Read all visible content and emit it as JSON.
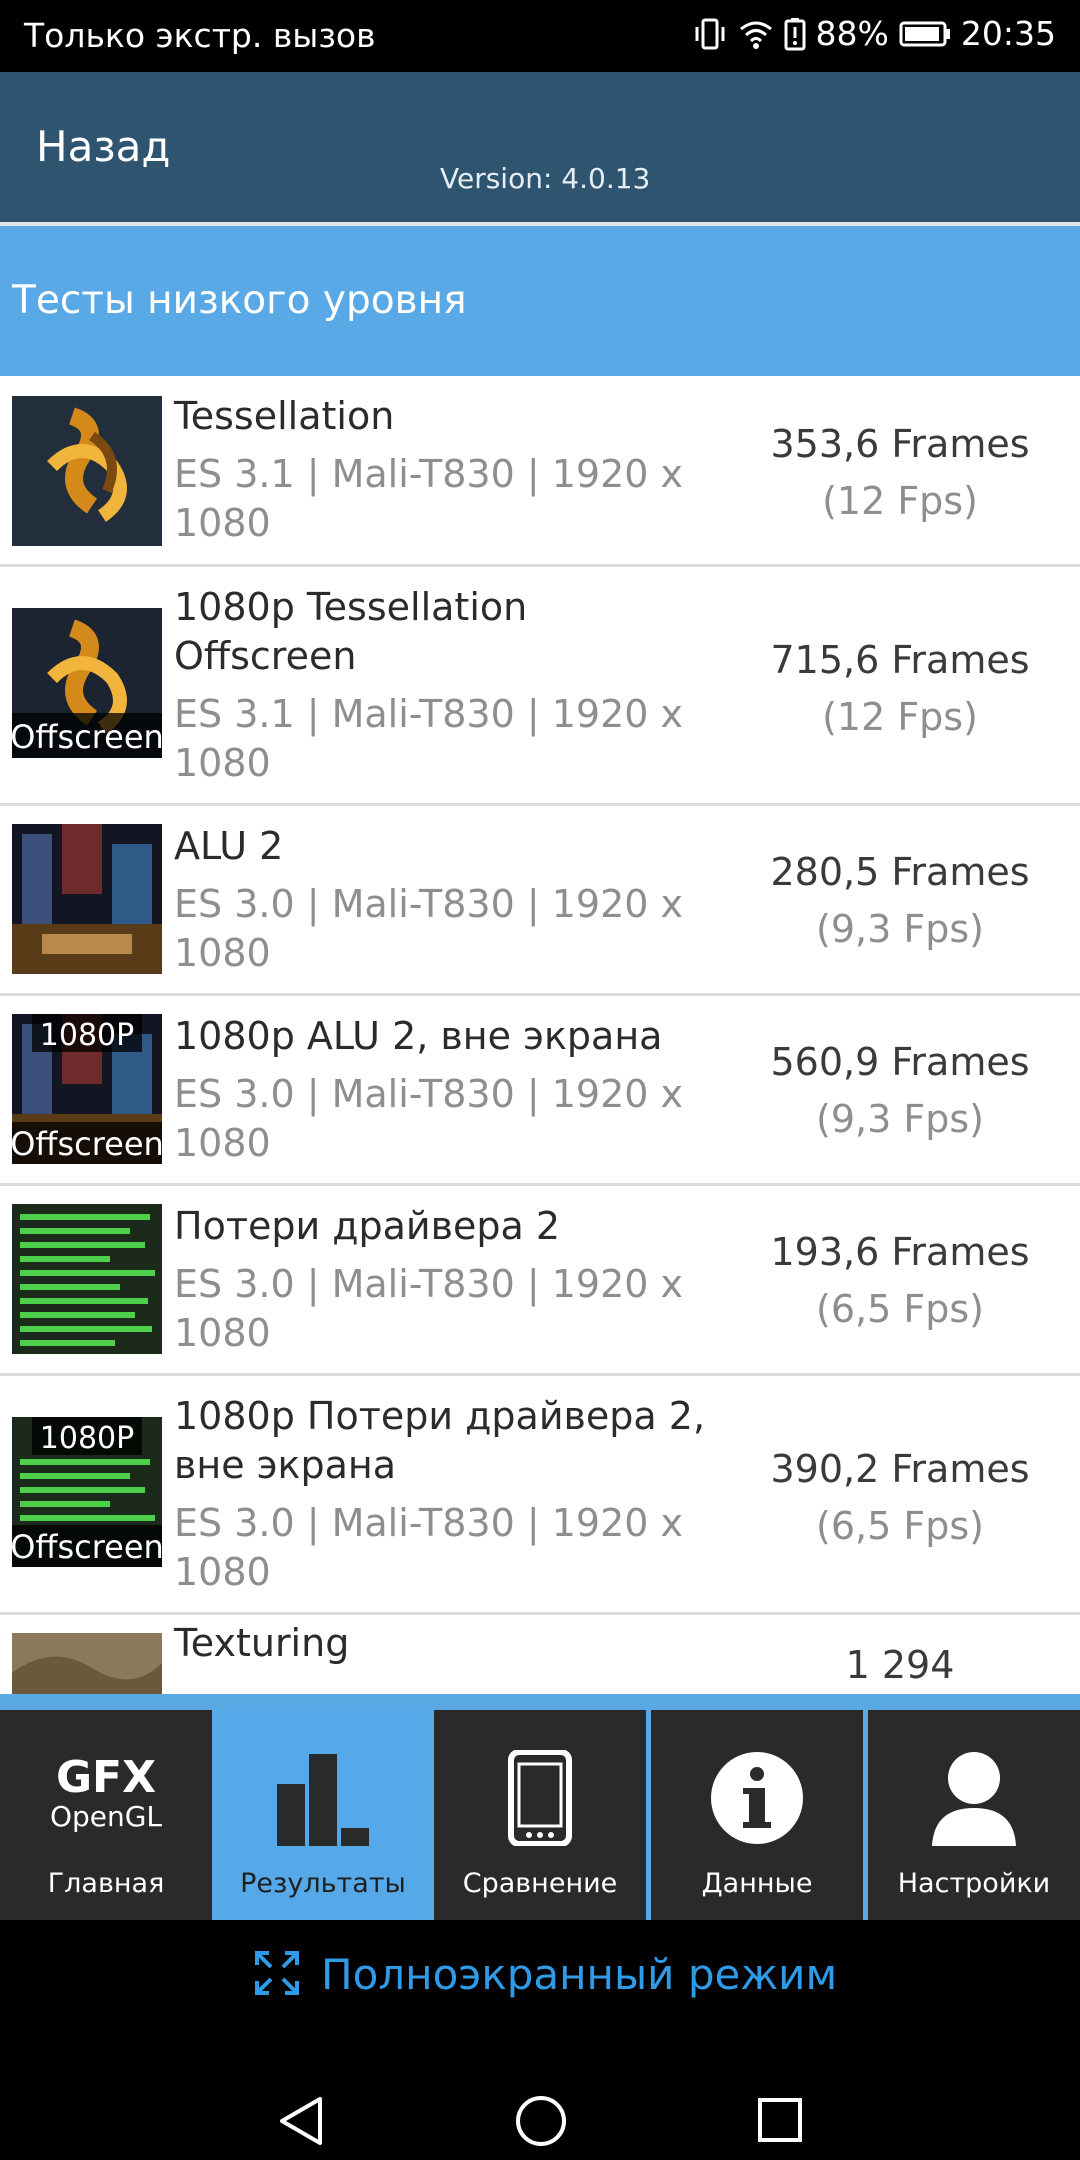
{
  "status_bar": {
    "carrier_text": "Только экстр. вызов",
    "battery_percent": "88%",
    "time": "20:35",
    "icons": [
      "vibrate-icon",
      "wifi-icon",
      "battery-alert-icon",
      "battery-icon"
    ]
  },
  "header": {
    "back_label": "Назад",
    "version": "Version: 4.0.13",
    "color": "#2e5470"
  },
  "section": {
    "title": "Тесты низкого уровня",
    "color": "#59a9e6"
  },
  "tests": [
    {
      "title": "Tessellation",
      "subtitle": "ES 3.1 | Mali-T830 | 1920 x 1080",
      "frames": "353,6 Frames",
      "fps": "(12 Fps)",
      "thumb": "tessellation-thumb"
    },
    {
      "title": "1080p Tessellation Offscreen",
      "subtitle": "ES 3.1 | Mali-T830 | 1920 x 1080",
      "frames": "715,6 Frames",
      "fps": "(12 Fps)",
      "thumb": "tessellation-offscreen-thumb",
      "thumb_badge": "Offscreen"
    },
    {
      "title": "ALU 2",
      "subtitle": "ES 3.0 | Mali-T830 | 1920 x 1080",
      "frames": "280,5 Frames",
      "fps": "(9,3 Fps)",
      "thumb": "alu2-thumb"
    },
    {
      "title": "1080p ALU 2, вне экрана",
      "subtitle": "ES 3.0 | Mali-T830 | 1920 x 1080",
      "frames": "560,9 Frames",
      "fps": "(9,3 Fps)",
      "thumb": "alu2-offscreen-thumb",
      "thumb_badge_top": "1080P",
      "thumb_badge": "Offscreen"
    },
    {
      "title": "Потери драйвера 2",
      "subtitle": "ES 3.0 | Mali-T830 | 1920 x 1080",
      "frames": "193,6 Frames",
      "fps": "(6,5 Fps)",
      "thumb": "driver-overhead-thumb"
    },
    {
      "title": "1080p Потери драйвера 2, вне экрана",
      "subtitle": "ES 3.0 | Mali-T830 | 1920 x 1080",
      "frames": "390,2 Frames",
      "fps": "(6,5 Fps)",
      "thumb": "driver-overhead-offscreen-thumb",
      "thumb_badge_top": "1080P",
      "thumb_badge": "Offscreen"
    },
    {
      "title": "Texturing",
      "frames": "1 294",
      "thumb": "texturing-thumb"
    }
  ],
  "nav": {
    "items": [
      {
        "label": "Главная",
        "icon": "gfx-opengl-logo",
        "logo_line1": "GFX",
        "logo_line2": "OpenGL"
      },
      {
        "label": "Результаты",
        "icon": "bar-chart-icon",
        "active": true
      },
      {
        "label": "Сравнение",
        "icon": "phone-icon"
      },
      {
        "label": "Данные",
        "icon": "info-icon"
      },
      {
        "label": "Настройки",
        "icon": "user-icon"
      }
    ],
    "active_color": "#55a9e8"
  },
  "fullscreen": {
    "label": "Полноэкранный режим",
    "color": "#2f9be8"
  },
  "system_nav": {
    "icons": [
      "back-triangle-icon",
      "home-circle-icon",
      "recents-square-icon"
    ]
  }
}
